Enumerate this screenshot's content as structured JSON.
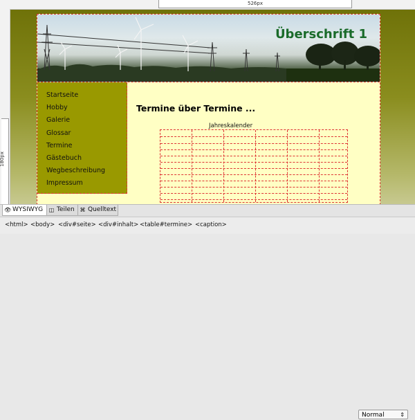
{
  "rulers": {
    "width_label": "526px",
    "height_label": "180px"
  },
  "page": {
    "header_title": "Überschrift 1",
    "nav": [
      "Startseite",
      "Hobby",
      "Galerie",
      "Glossar",
      "Termine",
      "Gästebuch",
      "Wegbeschreibung",
      "Impressum"
    ],
    "content_heading": "Termine über Termine ...",
    "table_caption": "Jahreskalender"
  },
  "tabs": [
    {
      "label": "WYSIWYG",
      "icon": "eye-icon"
    },
    {
      "label": "Teilen",
      "icon": "split-view-icon"
    },
    {
      "label": "Quelltext",
      "icon": "source-code-icon"
    }
  ],
  "format_select": {
    "value": "Normal"
  },
  "breadcrumb": [
    "<html>",
    "<body>",
    "<div#seite>",
    "<div#inhalt>",
    "<table#termine>",
    "<caption>"
  ]
}
